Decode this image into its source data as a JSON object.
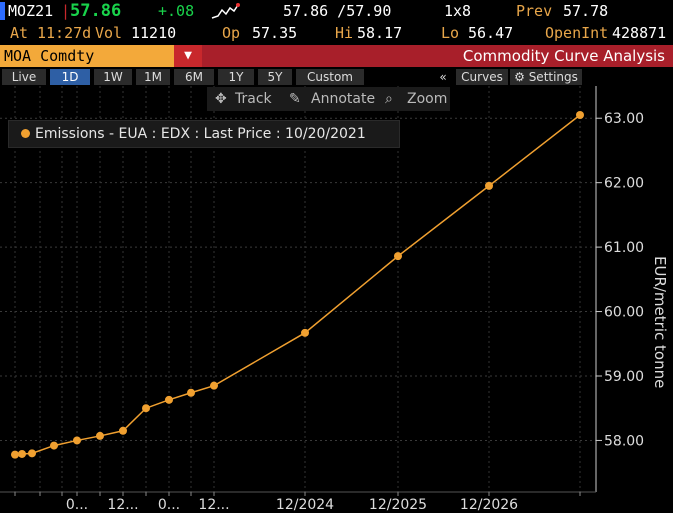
{
  "header": {
    "ticker": "MOZ21",
    "last": "57.86",
    "change": "+.08",
    "bid_ask": "57.86 /57.90",
    "size": "1x8",
    "prev_label": "Prev",
    "prev_value": "57.78",
    "at_label": "At",
    "time": "11:27d",
    "vol_label": "Vol",
    "vol_value": "11210",
    "op_label": "Op",
    "op_value": "57.35",
    "hi_label": "Hi",
    "hi_value": "58.17",
    "lo_label": "Lo",
    "lo_value": "56.47",
    "oi_label": "OpenInt",
    "oi_value": "428871"
  },
  "security": {
    "field": "MOA Comdty",
    "dropdown_icon": "chevron-down-icon",
    "title": "Commodity Curve Analysis"
  },
  "tabs": [
    {
      "label": "Live",
      "active": false
    },
    {
      "label": "1D",
      "active": true
    },
    {
      "label": "1W",
      "active": false
    },
    {
      "label": "1M",
      "active": false
    },
    {
      "label": "6M",
      "active": false
    },
    {
      "label": "1Y",
      "active": false
    },
    {
      "label": "5Y",
      "active": false
    },
    {
      "label": "Custom",
      "active": false
    }
  ],
  "right_controls": {
    "collapse": "«",
    "curves": "Curves",
    "settings": "Settings"
  },
  "toolbar": {
    "track": "Track",
    "annotate": "Annotate",
    "zoom": "Zoom"
  },
  "legend": {
    "text": "Emissions - EUA : EDX : Last Price : 10/20/2021"
  },
  "chart_data": {
    "type": "line",
    "ylabel": "EUR/metric tonne",
    "ylim": [
      57.2,
      63.5
    ],
    "yticks": [
      "58.00",
      "59.00",
      "60.00",
      "61.00",
      "62.00",
      "63.00"
    ],
    "xtick_labels": [
      "0...",
      "12...",
      "0...",
      "12...",
      "12/2024",
      "12/2025",
      "12/2026"
    ],
    "series": [
      {
        "color": "#f0a030",
        "x": [
          0,
          0.04,
          0.1,
          0.25,
          0.5,
          0.7,
          0.83,
          1.0,
          1.2,
          1.4,
          1.6,
          2.0,
          3.0,
          4.0,
          5.0,
          6.0
        ],
        "y": [
          57.78,
          57.79,
          57.8,
          57.92,
          58.0,
          58.07,
          58.15,
          58.5,
          58.63,
          58.74,
          58.85,
          59.67,
          60.86,
          61.95,
          63.05,
          63.05
        ]
      }
    ]
  }
}
